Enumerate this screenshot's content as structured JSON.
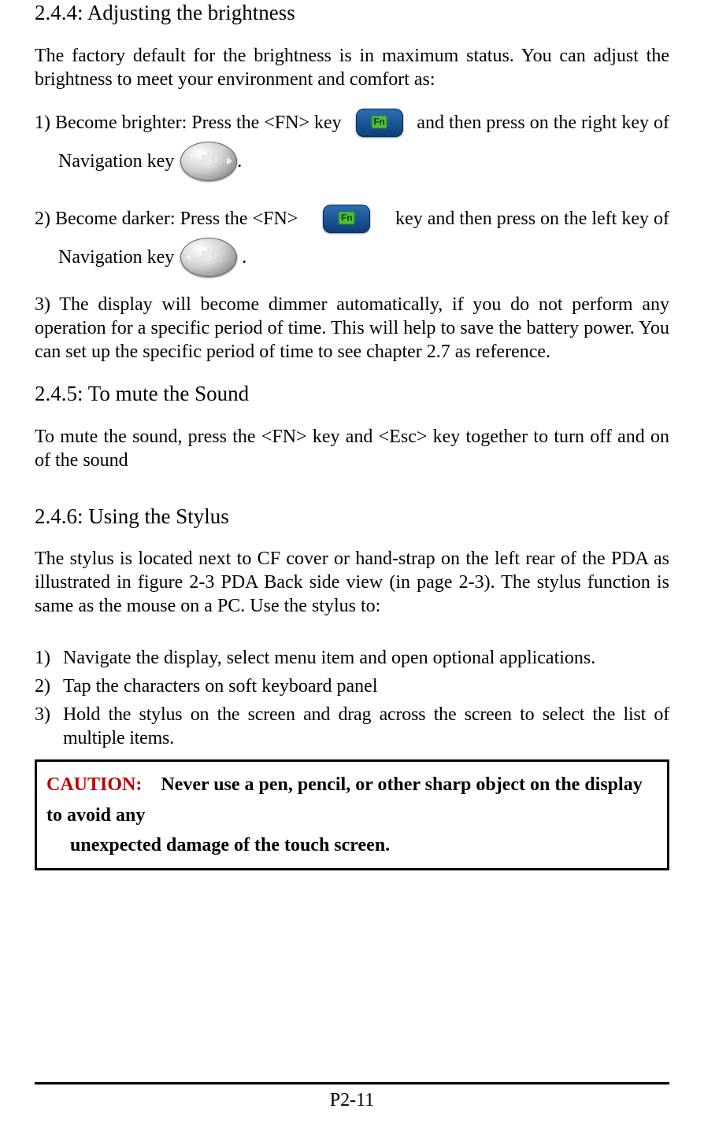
{
  "sections": {
    "s244": {
      "heading": "2.4.4: Adjusting the brightness",
      "intro": "The factory default for the brightness is in maximum status. You can adjust the brightness to meet your environment and comfort as:",
      "item1_a": "1) Become brighter: Press the <FN> key",
      "item1_b": "and then press on the right key of",
      "item1_c": "Navigation key",
      "item1_d": ".",
      "item2_a": "2) Become darker: Press the <FN>",
      "item2_b": "key and then press on the left key of",
      "item2_c": "Navigation key",
      "item2_d": ".",
      "item3": "3) The display will become dimmer automatically, if you do not perform any operation for a specific period of time. This will help to save the battery power. You can set up the specific period of time to see chapter 2.7 as reference."
    },
    "s245": {
      "heading": "2.4.5: To mute the Sound",
      "body": "To mute the sound, press the <FN> key and <Esc> key together to turn off and on of the sound"
    },
    "s246": {
      "heading": "2.4.6: Using the Stylus",
      "intro": "The stylus is located next to CF cover or hand-strap on the left rear of the PDA as illustrated in figure 2-3 PDA Back side view (in page 2-3). The stylus function is same as the mouse on a PC. Use the stylus to:",
      "list": [
        {
          "num": "1)",
          "text": "Navigate the display, select menu item and open optional applications."
        },
        {
          "num": "2)",
          "text": "Tap the characters on soft keyboard panel"
        },
        {
          "num": "3)",
          "text": "Hold the stylus on the screen and drag across the screen to select the list of multiple items."
        }
      ],
      "caution_label": "CAUTION:",
      "caution_line1": "Never use a pen, pencil, or other sharp object on the display to avoid any",
      "caution_line2": "unexpected damage of the touch screen."
    }
  },
  "footer": {
    "page": "P2-11"
  }
}
